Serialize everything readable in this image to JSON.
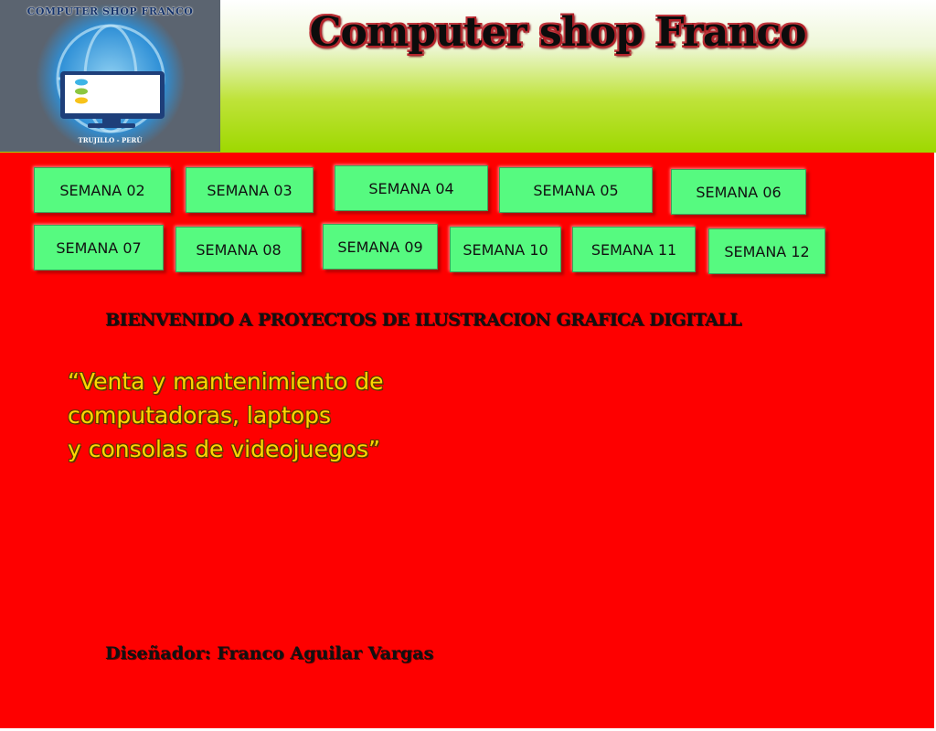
{
  "header": {
    "title": "Computer shop Franco",
    "logo": {
      "text": "COMPUTER SHOP FRANCO",
      "subtext": "TRUJILLO - PERÚ",
      "icon": "computer-monitor-icon"
    }
  },
  "nav": {
    "items": [
      {
        "label": "SEMANA 02"
      },
      {
        "label": "SEMANA 03"
      },
      {
        "label": "SEMANA 04"
      },
      {
        "label": "SEMANA 05"
      },
      {
        "label": "SEMANA 06"
      },
      {
        "label": "SEMANA 07"
      },
      {
        "label": "SEMANA 08"
      },
      {
        "label": "SEMANA 09"
      },
      {
        "label": "SEMANA 10"
      },
      {
        "label": "SEMANA 11"
      },
      {
        "label": "SEMANA 12"
      }
    ]
  },
  "main": {
    "welcome": "BIENVENIDO A PROYECTOS DE ILUSTRACION GRAFICA DIGITALL",
    "slogan_lines": [
      "“Venta y mantenimiento de",
      "computadoras, laptops",
      "y consolas de videojuegos”"
    ],
    "designer": "Diseñador: Franco Aguilar Vargas"
  },
  "colors": {
    "main_background": "#fe0000",
    "button": "#56fa80",
    "header_green": "#9ed800",
    "slogan": "#ffd700"
  }
}
